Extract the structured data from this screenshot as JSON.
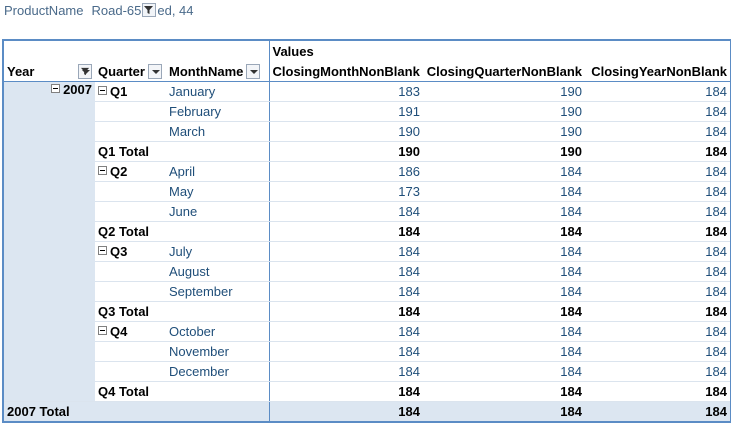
{
  "filter": {
    "label": "ProductName",
    "value_before": "Road-65",
    "value_after": "ed, 44"
  },
  "headers": {
    "values_caption": "Values",
    "year": "Year",
    "quarter": "Quarter",
    "month": "MonthName",
    "measures": [
      "ClosingMonthNonBlank",
      "ClosingQuarterNonBlank",
      "ClosingYearNonBlank"
    ]
  },
  "year": "2007",
  "quarters": [
    {
      "label": "Q1",
      "total_label": "Q1 Total",
      "total": [
        "190",
        "190",
        "184"
      ],
      "months": [
        {
          "name": "January",
          "values": [
            "183",
            "190",
            "184"
          ]
        },
        {
          "name": "February",
          "values": [
            "191",
            "190",
            "184"
          ]
        },
        {
          "name": "March",
          "values": [
            "190",
            "190",
            "184"
          ]
        }
      ]
    },
    {
      "label": "Q2",
      "total_label": "Q2 Total",
      "total": [
        "184",
        "184",
        "184"
      ],
      "months": [
        {
          "name": "April",
          "values": [
            "186",
            "184",
            "184"
          ]
        },
        {
          "name": "May",
          "values": [
            "173",
            "184",
            "184"
          ]
        },
        {
          "name": "June",
          "values": [
            "184",
            "184",
            "184"
          ]
        }
      ]
    },
    {
      "label": "Q3",
      "total_label": "Q3 Total",
      "total": [
        "184",
        "184",
        "184"
      ],
      "months": [
        {
          "name": "July",
          "values": [
            "184",
            "184",
            "184"
          ]
        },
        {
          "name": "August",
          "values": [
            "184",
            "184",
            "184"
          ]
        },
        {
          "name": "September",
          "values": [
            "184",
            "184",
            "184"
          ]
        }
      ]
    },
    {
      "label": "Q4",
      "total_label": "Q4 Total",
      "total": [
        "184",
        "184",
        "184"
      ],
      "months": [
        {
          "name": "October",
          "values": [
            "184",
            "184",
            "184"
          ]
        },
        {
          "name": "November",
          "values": [
            "184",
            "184",
            "184"
          ]
        },
        {
          "name": "December",
          "values": [
            "184",
            "184",
            "184"
          ]
        }
      ]
    }
  ],
  "grand_total": {
    "label": "2007 Total",
    "values": [
      "184",
      "184",
      "184"
    ]
  },
  "icons": {
    "filter": "funnel-icon",
    "collapse": "minus-box-icon",
    "dropdown": "chevron-down-icon"
  },
  "colors": {
    "accent_border": "#5b8cc5",
    "row_band": "#dce6f1",
    "value_text": "#1f4e79"
  }
}
